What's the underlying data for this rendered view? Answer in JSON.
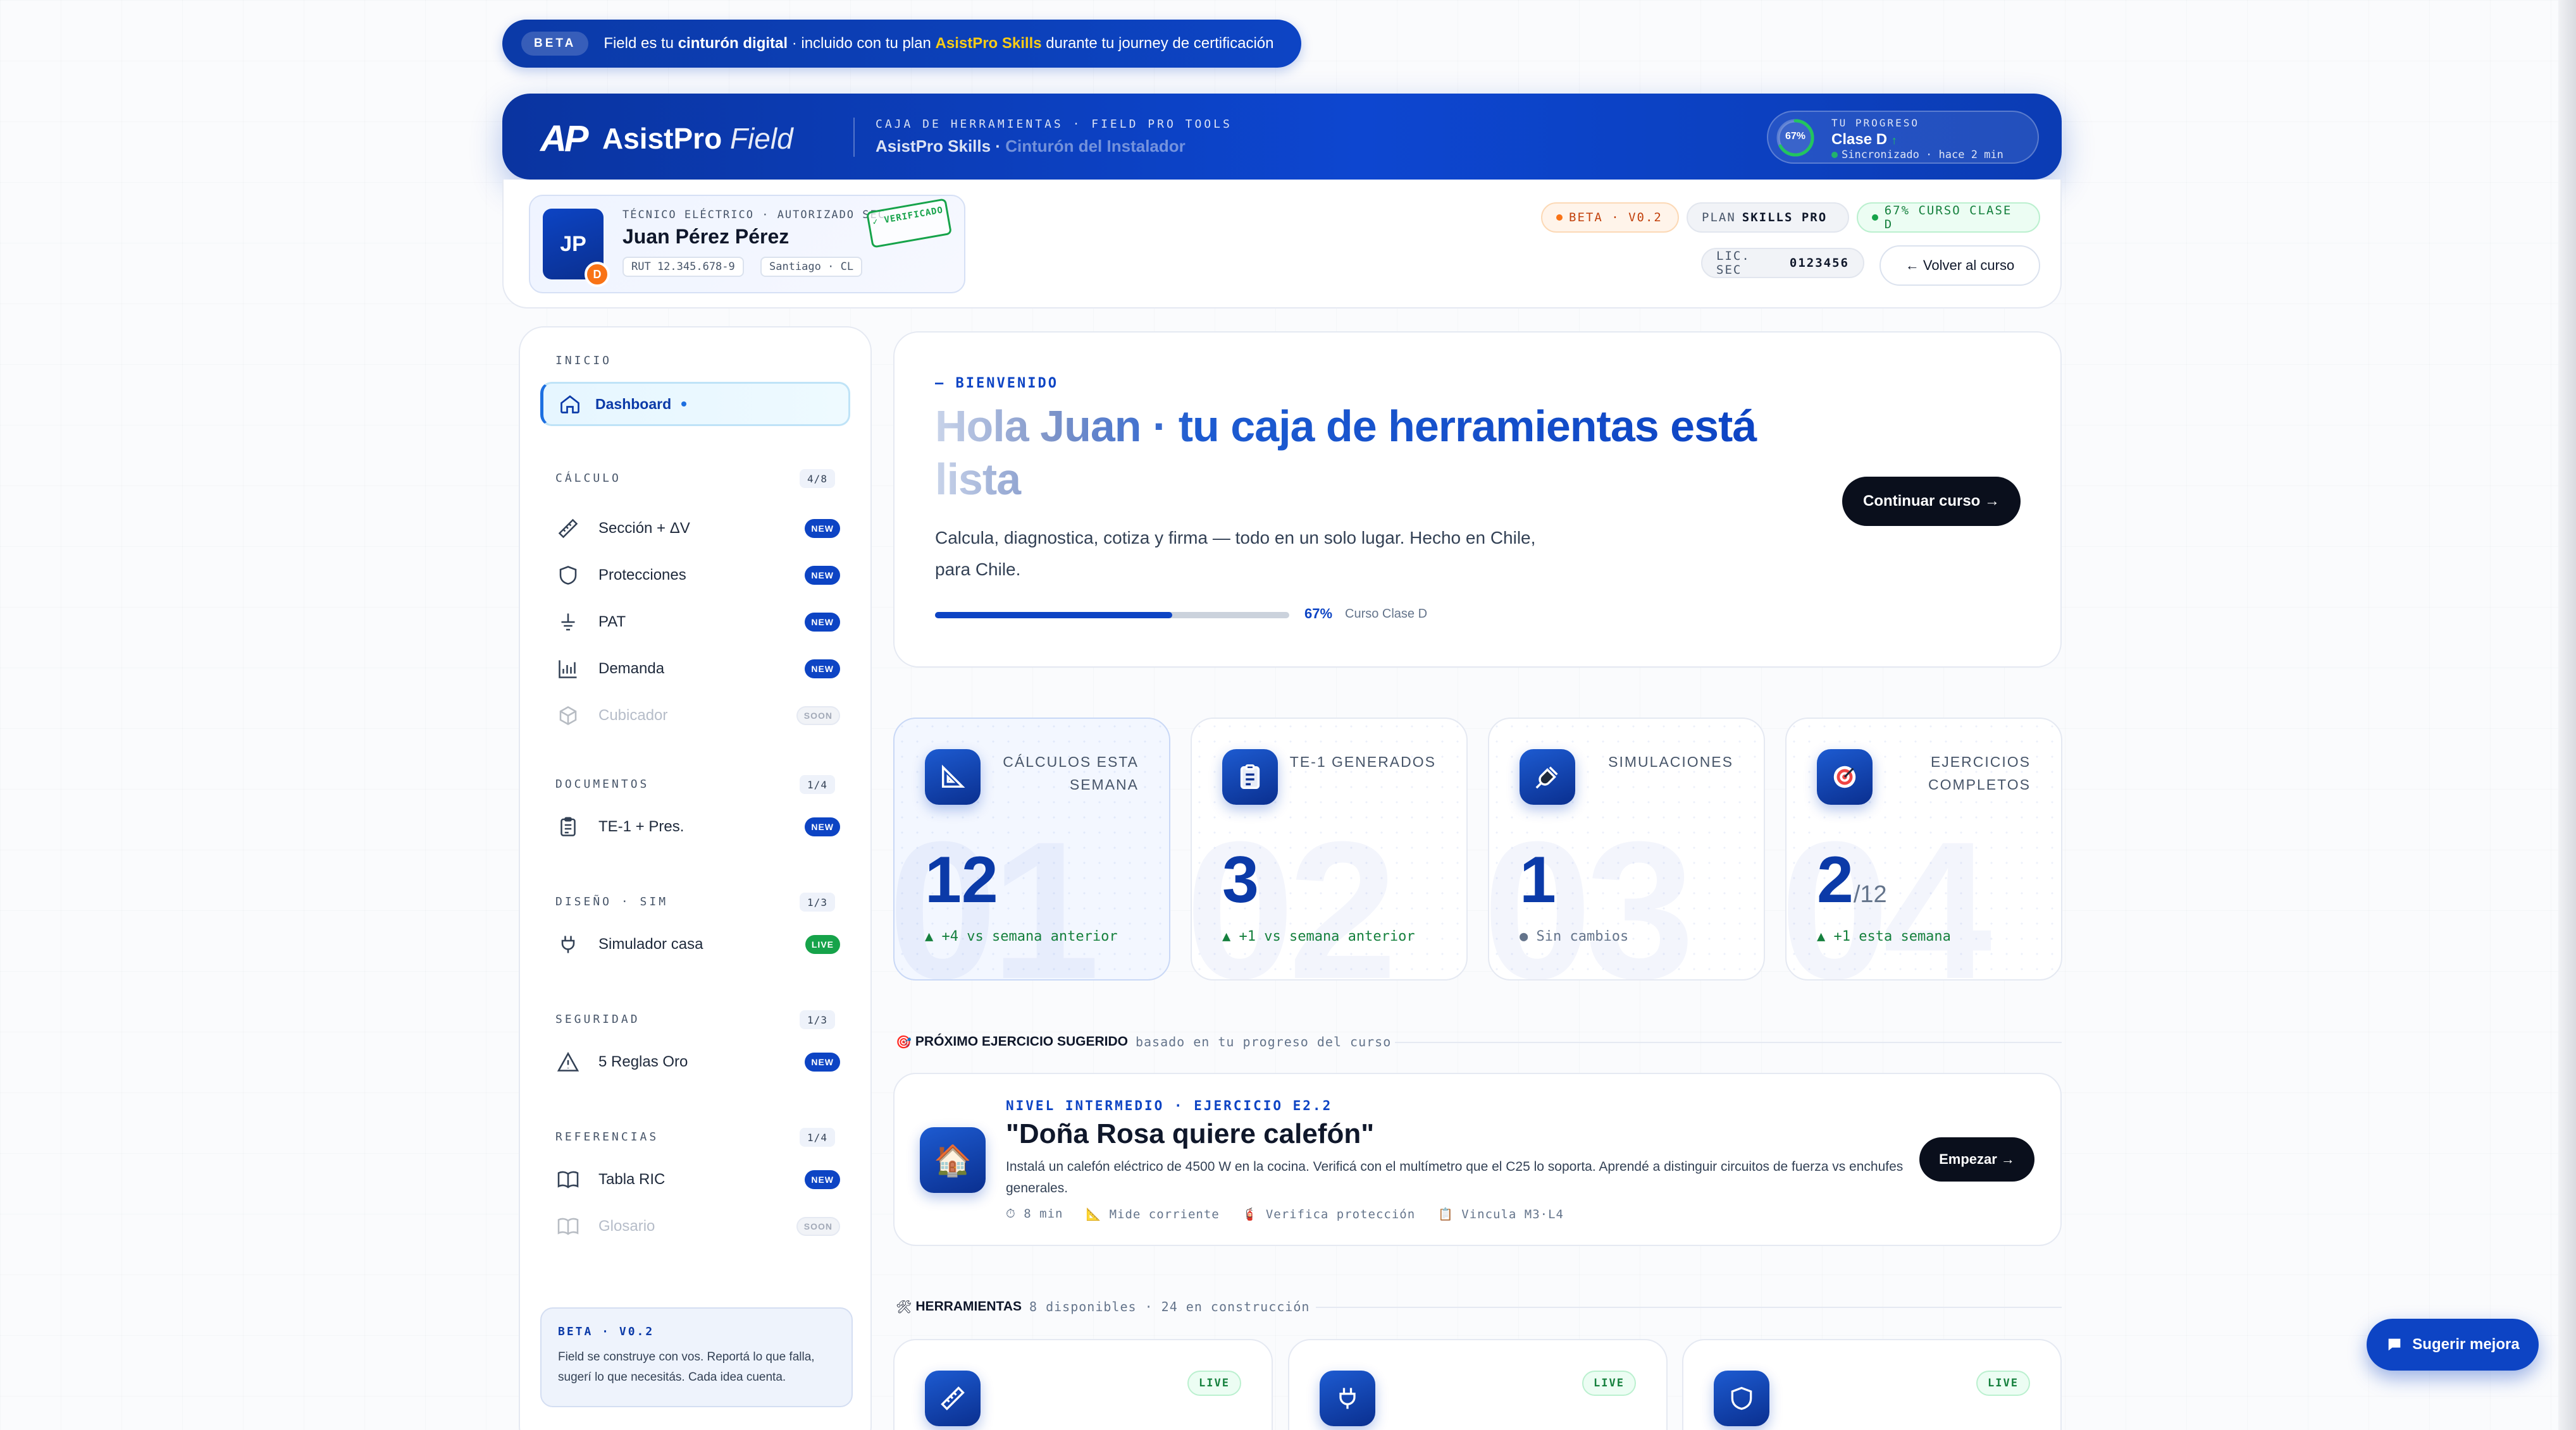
{
  "banner": {
    "pill": "BETA",
    "text_a": "Field es tu ",
    "text_b": "cinturón digital",
    "text_c": " · incluido con tu plan ",
    "text_d": "AsistPro Skills",
    "text_e": " durante tu journey de certificación"
  },
  "header": {
    "logo_mark": "AP",
    "logo_name": "AsistPro",
    "logo_product": "Field",
    "subtitle_top": "CAJA DE HERRAMIENTAS · FIELD PRO TOOLS",
    "subtitle_main": "AsistPro Skills · ",
    "subtitle_fade": "Cinturón del Instalador",
    "progress": {
      "label": "TU PROGRESO",
      "percent_text": "67%",
      "percent": 0.67,
      "level": "Clase D",
      "level_arrow": "↑",
      "sync": "Sincronizado · hace 2 min"
    }
  },
  "profile": {
    "initials": "JP",
    "level_badge": "D",
    "role": "TÉCNICO ELÉCTRICO · AUTORIZADO SEC",
    "name": "Juan Pérez Pérez",
    "rut": "RUT 12.345.678-9",
    "location": "Santiago · CL",
    "stamp": "✓ VERIFICADO"
  },
  "tags": {
    "beta": "BETA · V0.2",
    "plan_label": "PLAN",
    "plan_value": "SKILLS PRO",
    "course": "67% CURSO CLASE D",
    "lic_label": "LIC. SEC",
    "lic_value": "0123456",
    "back": "← Volver al curso"
  },
  "sidebar": {
    "inicio": "INICIO",
    "dashboard": "Dashboard",
    "calculo": {
      "title": "CÁLCULO",
      "count": "4/8"
    },
    "calc_items": [
      {
        "label": "Sección + ΔV",
        "badge": "NEW",
        "icon": "ruler-icon"
      },
      {
        "label": "Protecciones",
        "badge": "NEW",
        "icon": "shield-icon"
      },
      {
        "label": "PAT",
        "badge": "NEW",
        "icon": "ground-icon"
      },
      {
        "label": "Demanda",
        "badge": "NEW",
        "icon": "bar-chart-icon"
      },
      {
        "label": "Cubicador",
        "badge": "SOON",
        "icon": "cube-icon"
      }
    ],
    "documentos": {
      "title": "DOCUMENTOS",
      "count": "1/4"
    },
    "doc_items": [
      {
        "label": "TE-1 + Pres.",
        "badge": "NEW",
        "icon": "clipboard-icon"
      }
    ],
    "diseno": {
      "title": "DISEÑO · SIM",
      "count": "1/3"
    },
    "dis_items": [
      {
        "label": "Simulador casa",
        "badge": "LIVE",
        "icon": "plug-icon"
      }
    ],
    "seguridad": {
      "title": "SEGURIDAD",
      "count": "1/3"
    },
    "seg_items": [
      {
        "label": "5 Reglas Oro",
        "badge": "NEW",
        "icon": "warning-icon"
      }
    ],
    "referencias": {
      "title": "REFERENCIAS",
      "count": "1/4"
    },
    "ref_items": [
      {
        "label": "Tabla RIC",
        "badge": "NEW",
        "icon": "book-icon"
      },
      {
        "label": "Glosario",
        "badge": "SOON",
        "icon": "book-icon"
      }
    ],
    "beta_box": {
      "title": "BETA · V0.2",
      "text": "Field se construye con vos. Reportá lo que falla, sugerí lo que necesitás. Cada idea cuenta."
    }
  },
  "hero": {
    "kicker": "— BIENVENIDO",
    "title": "Hola Juan · tu caja de herramientas está lista",
    "desc": "Calcula, diagnostica, cotiza y firma — todo en un solo lugar. Hecho en Chile, para Chile.",
    "progress": 0.67,
    "progress_text": "67%",
    "progress_label": "Curso Clase D",
    "cta": "Continuar curso →"
  },
  "stats": [
    {
      "label": "CÁLCULOS ESTA SEMANA",
      "value": "12",
      "suffix": "",
      "delta": "▲ +4 vs semana anterior",
      "ghost": "01",
      "icon": "set-square-icon"
    },
    {
      "label": "TE-1 GENERADOS",
      "value": "3",
      "suffix": "",
      "delta": "▲ +1 vs semana anterior",
      "ghost": "02",
      "icon": "clipboard-icon"
    },
    {
      "label": "SIMULACIONES",
      "value": "1",
      "suffix": "",
      "delta": "● Sin cambios",
      "ghost": "03",
      "icon": "plug-icon"
    },
    {
      "label": "EJERCICIOS COMPLETOS",
      "value": "2",
      "suffix": "/12",
      "delta": "▲ +1 esta semana",
      "ghost": "04",
      "icon": "target-icon"
    }
  ],
  "next": {
    "title": "PRÓXIMO EJERCICIO SUGERIDO",
    "hint": "basado en tu progreso del curso"
  },
  "exercise": {
    "kicker": "NIVEL INTERMEDIO · EJERCICIO E2.2",
    "title": "\"Doña Rosa quiere calefón\"",
    "desc": "Instalá un calefón eléctrico de 4500 W en la cocina. Verificá con el multímetro que el C25 lo soporta. Aprendé a distinguir circuitos de fuerza vs enchufes generales.",
    "meta": [
      "⏱ 8 min",
      "📐 Mide corriente",
      "🧯 Verifica protección",
      "📋 Vincula M3·L4"
    ],
    "cta": "Empezar →"
  },
  "tools": {
    "title": "HERRAMIENTAS",
    "hint": "8 disponibles · 24 en construcción",
    "items": [
      {
        "badge": "LIVE",
        "icon": "ruler-icon"
      },
      {
        "badge": "LIVE",
        "icon": "plug-icon"
      },
      {
        "badge": "LIVE",
        "icon": "shield-icon"
      }
    ]
  },
  "fab": "Sugerir mejora",
  "colors": {
    "brand": "#0d44c4",
    "brand_dark": "#0a2f8f",
    "success": "#16a34a",
    "warning": "#f97316"
  }
}
